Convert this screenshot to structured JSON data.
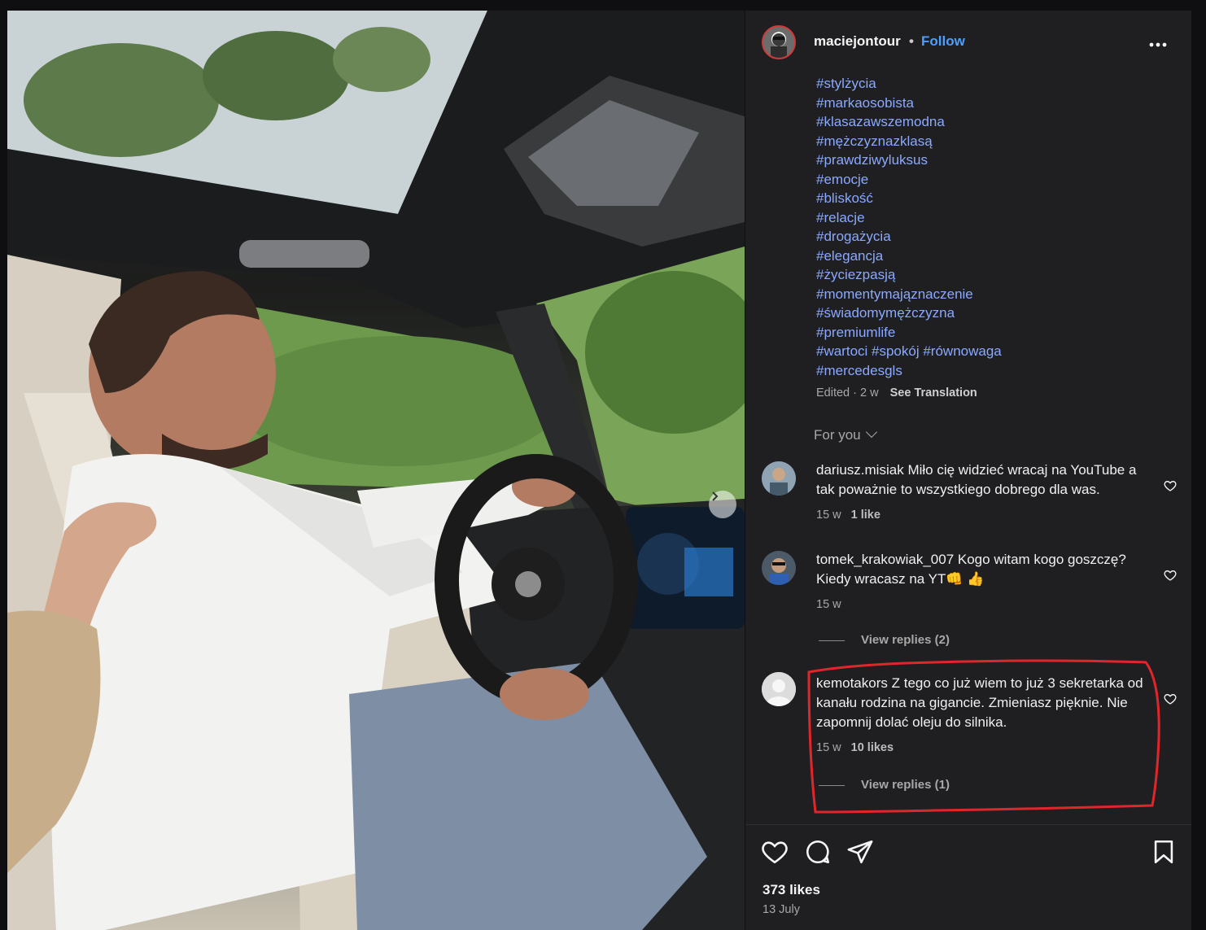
{
  "post": {
    "username": "maciejontour",
    "separator": "•",
    "follow_label": "Follow",
    "more_label": "•••",
    "hashtags": [
      "#stylżycia",
      "#markaosobista",
      "#klasazawszemodna",
      "#mężczyznazklasą",
      "#prawdziwyluksus",
      "#emocje",
      "#bliskość",
      "#relacje",
      "#drogażycia",
      "#elegancja",
      "#życiezpasją",
      "#momentymająznaczenie",
      "#świadomymężczyzna",
      "#premiumlife",
      "#wartoci #spokój #równowaga",
      "#mercedesgls"
    ],
    "edited_meta": "Edited · 2 w",
    "see_translation": "See Translation",
    "for_you_label": "For you",
    "likes_label": "373 likes",
    "date": "13 July"
  },
  "comments": [
    {
      "username": "dariusz.misiak",
      "text": "Miło cię widzieć wracaj na YouTube a tak poważnie to wszystkiego dobrego dla was.",
      "age": "15 w",
      "likes": "1 like"
    },
    {
      "username": "tomek_krakowiak_007",
      "text": "Kogo witam kogo goszczę? Kiedy wracasz na YT👊 👍",
      "age": "15 w",
      "likes": "",
      "replies": "View replies (2)"
    },
    {
      "username": "kemotakors",
      "text": "Z tego co już wiem to już 3 sekretarka od kanału rodzina na gigancie. Zmieniasz pięknie. Nie zapomnij dolać oleju do silnika.",
      "age": "15 w",
      "likes": "10 likes",
      "replies": "View replies (1)"
    }
  ],
  "colors": {
    "link_blue": "#4d9fff",
    "hashtag": "#8aa9ff",
    "panel_bg": "#1f1f22",
    "highlight_red": "#e0262b"
  }
}
